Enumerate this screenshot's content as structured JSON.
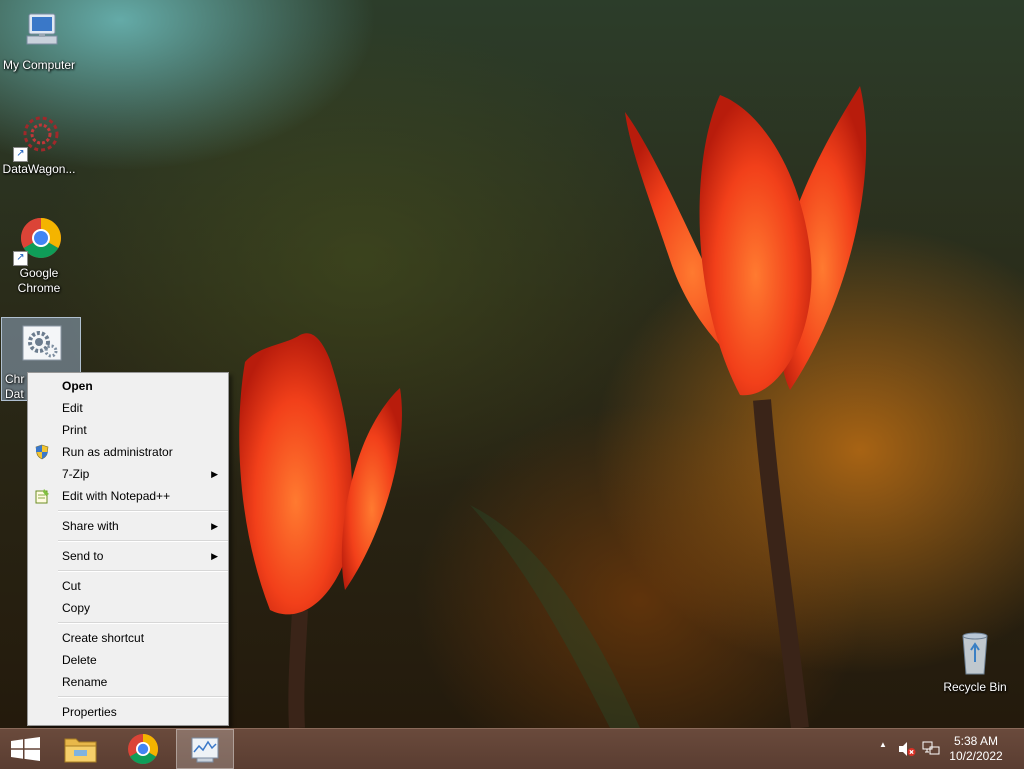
{
  "desktop": {
    "icons": [
      {
        "label": "My Computer",
        "icon": "computer-icon"
      },
      {
        "label": "DataWagon...",
        "icon": "datawagon-icon",
        "shortcut": true
      },
      {
        "label": "Google Chrome",
        "icon": "chrome-icon",
        "shortcut": true
      },
      {
        "label": "Chr\nDat",
        "icon": "gear-settings-icon",
        "selected": true
      },
      {
        "label": "Recycle Bin",
        "icon": "recycle-bin-icon"
      }
    ]
  },
  "context_menu": {
    "items": [
      {
        "label": "Open",
        "default": true
      },
      {
        "label": "Edit"
      },
      {
        "label": "Print"
      },
      {
        "label": "Run as administrator",
        "icon": "uac-shield-icon"
      },
      {
        "label": "7-Zip",
        "submenu": true
      },
      {
        "label": "Edit with Notepad++",
        "icon": "notepad-plus-plus-icon"
      },
      {
        "separator": true
      },
      {
        "label": "Share with",
        "submenu": true
      },
      {
        "separator": true
      },
      {
        "label": "Send to",
        "submenu": true
      },
      {
        "separator": true
      },
      {
        "label": "Cut"
      },
      {
        "label": "Copy"
      },
      {
        "separator": true
      },
      {
        "label": "Create shortcut"
      },
      {
        "label": "Delete"
      },
      {
        "label": "Rename"
      },
      {
        "separator": true
      },
      {
        "label": "Properties"
      }
    ],
    "submenu_arrow": "▶"
  },
  "taskbar": {
    "buttons": [
      "windows-start-icon",
      "file-explorer-icon",
      "chrome-icon",
      "system-monitor-icon"
    ],
    "tray": {
      "show_hidden_arrow": "▲",
      "icons": [
        "speaker-muted-icon",
        "network-icon"
      ],
      "time": "5:38 AM",
      "date": "10/2/2022"
    }
  }
}
